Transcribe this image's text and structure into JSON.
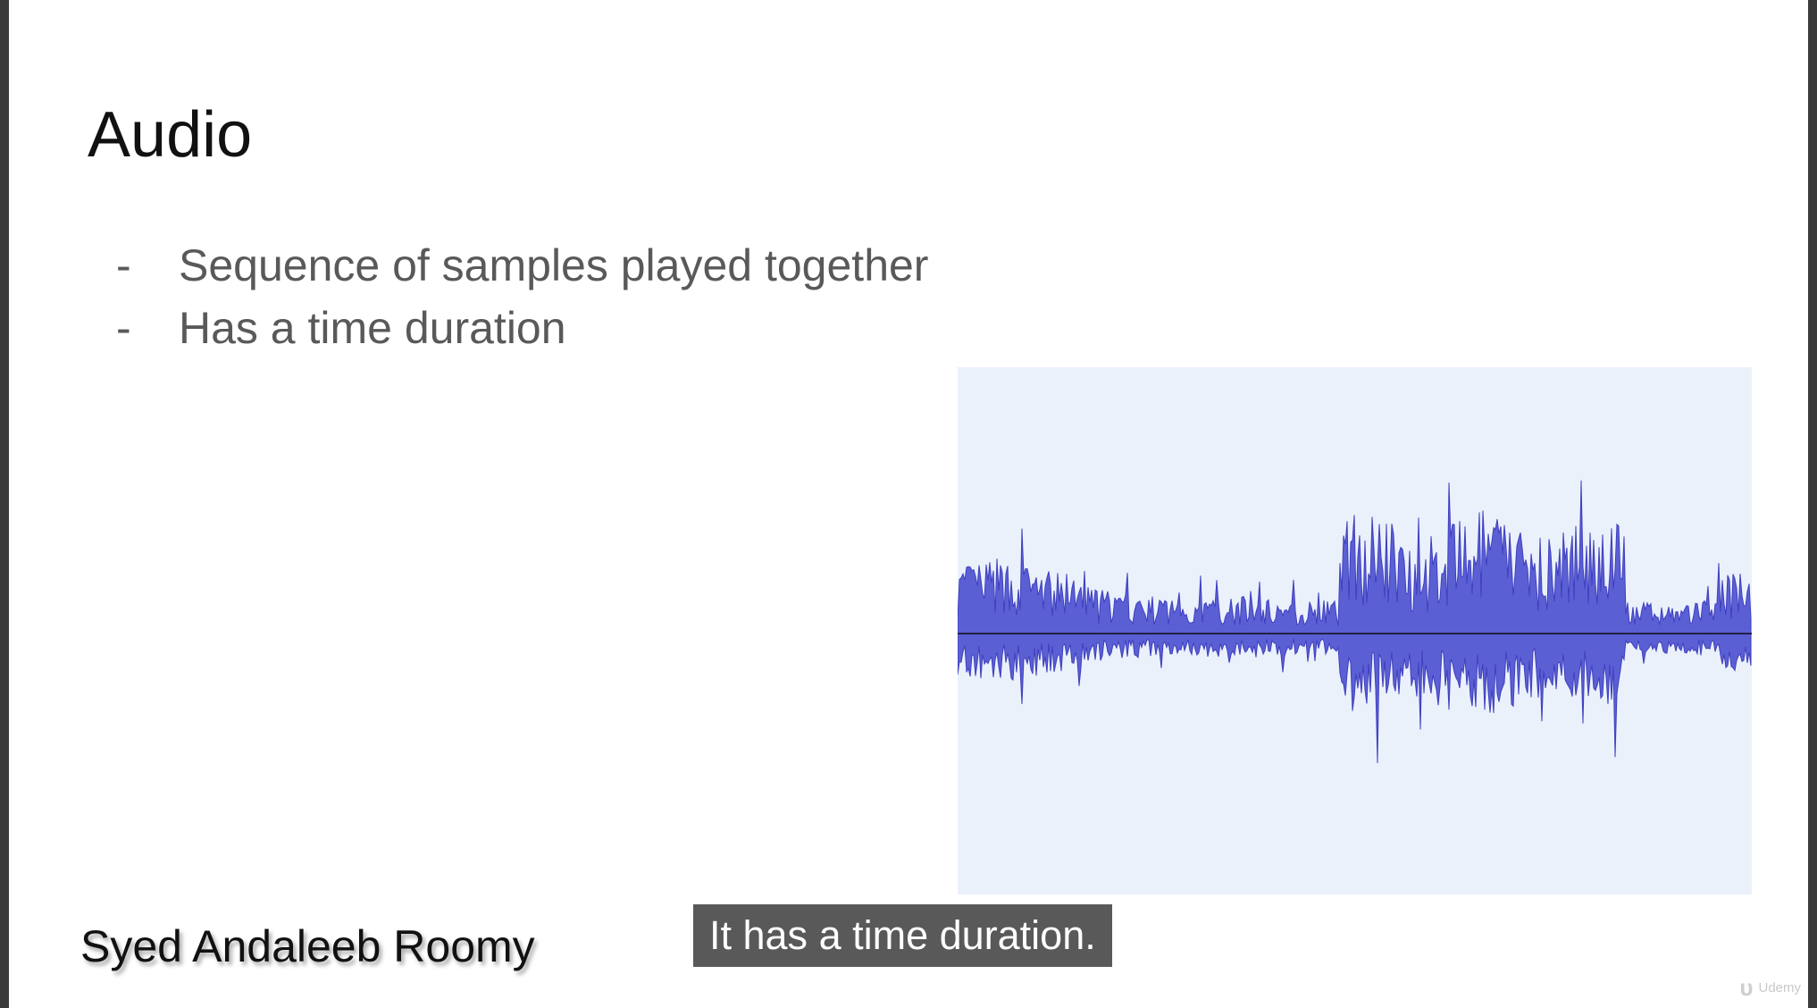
{
  "slide": {
    "title": "Audio",
    "bullets": [
      {
        "marker": "-",
        "text": "Sequence of samples played together"
      },
      {
        "marker": "-",
        "text": "Has a time duration"
      }
    ],
    "author": "Syed Andaleeb Roomy"
  },
  "subtitle": {
    "text": "It has a time duration."
  },
  "watermark": {
    "logo_text": "ᴜ",
    "brand": "Udemy"
  },
  "colors": {
    "waveform": "#5b5fd4",
    "waveform_background": "#eaf1fb",
    "caption_background": "#595959",
    "bullet_text": "#595959"
  },
  "waveform_image": {
    "icon": "audio-waveform"
  }
}
